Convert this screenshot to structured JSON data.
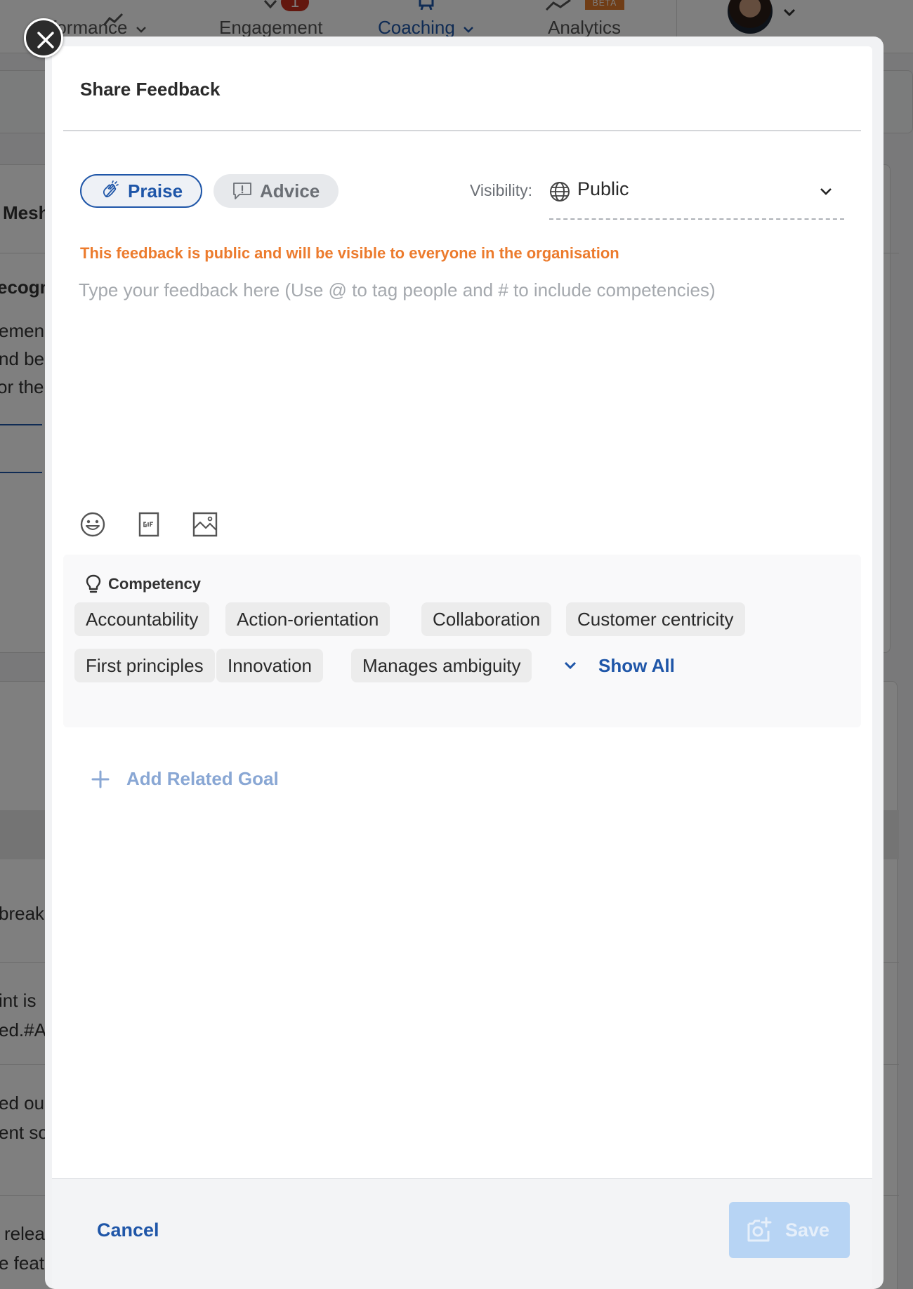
{
  "background": {
    "nav": {
      "performance": "erformance",
      "engagement": "Engagement",
      "engagement_badge": "1",
      "coaching": "Coaching",
      "analytics": "Analytics",
      "beta": "BETA"
    },
    "fragments": [
      "Mesh",
      "ecogn",
      "emen",
      "nd be",
      "or the",
      "break",
      "int is",
      "ed.#A",
      "ed ou",
      "ent so",
      "relea",
      "e featu"
    ]
  },
  "modal": {
    "title": "Share Feedback",
    "types": [
      {
        "label": "Praise",
        "icon": "clap-icon",
        "selected": true
      },
      {
        "label": "Advice",
        "icon": "advice-icon",
        "selected": false
      }
    ],
    "visibility": {
      "label": "Visibility:",
      "value": "Public",
      "icon": "globe-icon"
    },
    "warning": "This feedback is public and will be visible to everyone in the organisation",
    "input": {
      "placeholder": "Type your feedback here (Use @ to tag people and # to include competencies)",
      "value": ""
    },
    "tools": [
      "emoji-icon",
      "gif-icon",
      "image-icon"
    ],
    "competency": {
      "title": "Competency",
      "icon": "bulb-icon",
      "tags": [
        "Accountability",
        "Action-orientation",
        "Collaboration",
        "Customer centricity",
        "First principles",
        "Innovation",
        "Manages ambiguity"
      ],
      "show_all": "Show All"
    },
    "add_goal": "Add Related Goal",
    "footer": {
      "cancel": "Cancel",
      "save": "Save"
    },
    "colors": {
      "accent": "#1f56a8",
      "warning": "#ec7b2d",
      "save_disabled": "#b7d4f4"
    }
  }
}
